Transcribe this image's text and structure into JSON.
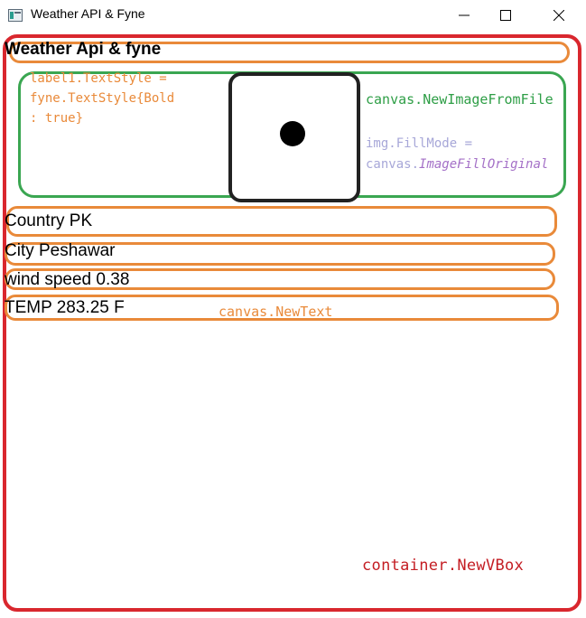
{
  "window": {
    "title": "Weather API & Fyne",
    "icon": "app-window-icon"
  },
  "heading": "Weather Api & fyne",
  "annotations": {
    "label_style_line1": "label1.TextStyle =",
    "label_style_line2": "fyne.TextStyle{Bold",
    "label_style_line3": ": true}",
    "image_from_file": "canvas.NewImageFromFile",
    "fill_mode": "img.FillMode =",
    "fill_mode_value_prefix": "canvas.",
    "fill_mode_value": "ImageFillOriginal",
    "new_text": "canvas.NewText",
    "vbox": "container.NewVBox"
  },
  "weather": {
    "country": "Country PK",
    "city": "City Peshawar",
    "wind": "wind speed 0.38",
    "temp": "TEMP 283.25 F"
  },
  "colors": {
    "vbox_outline": "#d9272e",
    "text_outline": "#e98a3a",
    "image_outline": "#3aa651"
  }
}
